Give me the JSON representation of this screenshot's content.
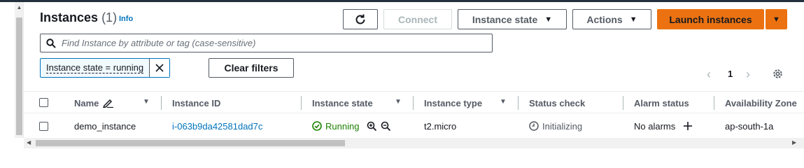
{
  "header": {
    "title": "Instances",
    "count": "(1)",
    "info": "Info"
  },
  "toolbar": {
    "connect_label": "Connect",
    "instance_state_label": "Instance state",
    "actions_label": "Actions",
    "launch_label": "Launch instances"
  },
  "search": {
    "placeholder": "Find Instance by attribute or tag (case-sensitive)"
  },
  "filters": {
    "token_label": "Instance state = running",
    "clear_label": "Clear filters"
  },
  "pagination": {
    "current_page": "1"
  },
  "table": {
    "headers": {
      "name": "Name",
      "instance_id": "Instance ID",
      "instance_state": "Instance state",
      "instance_type": "Instance type",
      "status_check": "Status check",
      "alarm_status": "Alarm status",
      "availability_zone": "Availability Zone"
    },
    "rows": [
      {
        "name": "demo_instance",
        "instance_id": "i-063b9da42581dad7c",
        "instance_state": "Running",
        "instance_type": "t2.micro",
        "status_check": "Initializing",
        "alarm_status": "No alarms",
        "availability_zone": "ap-south-1a"
      }
    ]
  },
  "colors": {
    "primary": "#ec7211",
    "link": "#0073bb",
    "running": "#1d8102",
    "border": "#545b64"
  },
  "icons": [
    "refresh-icon",
    "caret-down-icon",
    "search-icon",
    "close-icon",
    "chevron-left-icon",
    "chevron-right-icon",
    "settings-gear-icon",
    "edit-pencil-icon",
    "sort-caret-icon",
    "status-running-icon",
    "zoom-in-icon",
    "zoom-out-icon",
    "clock-icon",
    "plus-icon"
  ]
}
